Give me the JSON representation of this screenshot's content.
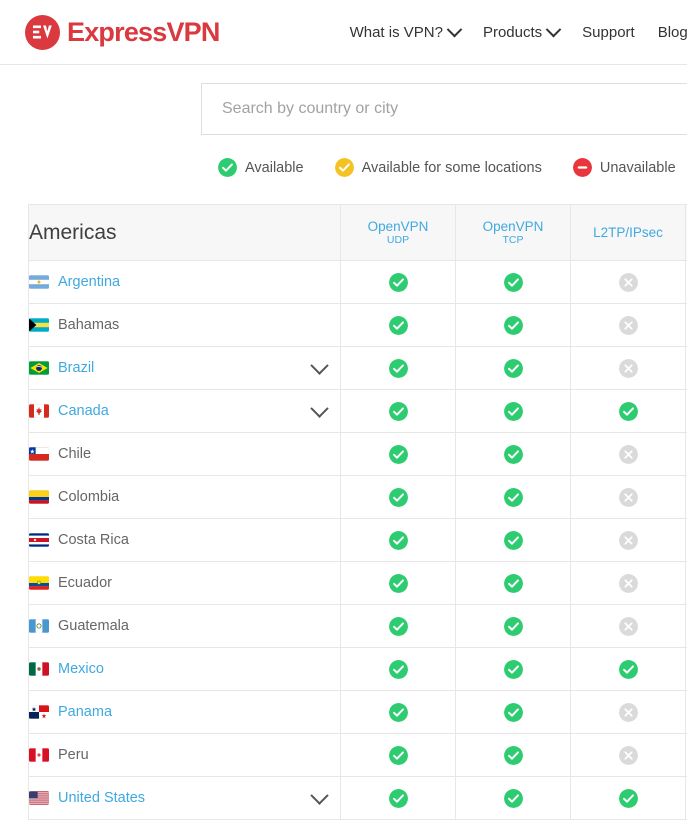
{
  "header": {
    "brand_name": "ExpressVPN",
    "brand_icon": "expressvpn-ev-logo-icon",
    "nav": [
      {
        "label": "What is VPN?",
        "has_dropdown": true
      },
      {
        "label": "Products",
        "has_dropdown": true
      },
      {
        "label": "Support",
        "has_dropdown": false
      },
      {
        "label": "Blog",
        "has_dropdown": false
      }
    ]
  },
  "search": {
    "value": "",
    "placeholder": "Search by country or city",
    "icon": "search-input"
  },
  "legend": [
    {
      "label": "Available",
      "icon": "check-circle-icon",
      "color": "#2ecc71"
    },
    {
      "label": "Available for some locations",
      "icon": "check-circle-icon",
      "color": "#f5c224"
    },
    {
      "label": "Unavailable",
      "icon": "minus-circle-icon",
      "color": "#e8363d"
    }
  ],
  "colors": {
    "brand_red": "#da3940",
    "link_blue": "#3fa9e0",
    "available_green": "#2ecc71",
    "partial_yellow": "#f5c224",
    "unavailable_red": "#e8363d",
    "cell_off_gray": "#dadada",
    "header_bg": "#f7f7f7",
    "border": "#e7e7e7"
  },
  "table": {
    "region_title": "Americas",
    "columns": [
      {
        "main": "OpenVPN",
        "sub": "UDP"
      },
      {
        "main": "OpenVPN",
        "sub": "TCP"
      },
      {
        "main": "L2TP/IPsec",
        "sub": ""
      },
      {
        "main": "",
        "sub": ""
      }
    ],
    "rows": [
      {
        "country": "Argentina",
        "flag": "flag-argentina",
        "is_link": true,
        "expandable": false,
        "status": [
          "available",
          "available",
          "off",
          "off"
        ]
      },
      {
        "country": "Bahamas",
        "flag": "flag-bahamas",
        "is_link": false,
        "expandable": false,
        "status": [
          "available",
          "available",
          "off",
          "off"
        ]
      },
      {
        "country": "Brazil",
        "flag": "flag-brazil",
        "is_link": true,
        "expandable": true,
        "status": [
          "available",
          "available",
          "off",
          "off"
        ]
      },
      {
        "country": "Canada",
        "flag": "flag-canada",
        "is_link": true,
        "expandable": true,
        "status": [
          "available",
          "available",
          "available",
          "off"
        ]
      },
      {
        "country": "Chile",
        "flag": "flag-chile",
        "is_link": false,
        "expandable": false,
        "status": [
          "available",
          "available",
          "off",
          "off"
        ]
      },
      {
        "country": "Colombia",
        "flag": "flag-colombia",
        "is_link": false,
        "expandable": false,
        "status": [
          "available",
          "available",
          "off",
          "off"
        ]
      },
      {
        "country": "Costa Rica",
        "flag": "flag-costa-rica",
        "is_link": false,
        "expandable": false,
        "status": [
          "available",
          "available",
          "off",
          "off"
        ]
      },
      {
        "country": "Ecuador",
        "flag": "flag-ecuador",
        "is_link": false,
        "expandable": false,
        "status": [
          "available",
          "available",
          "off",
          "off"
        ]
      },
      {
        "country": "Guatemala",
        "flag": "flag-guatemala",
        "is_link": false,
        "expandable": false,
        "status": [
          "available",
          "available",
          "off",
          "off"
        ]
      },
      {
        "country": "Mexico",
        "flag": "flag-mexico",
        "is_link": true,
        "expandable": false,
        "status": [
          "available",
          "available",
          "available",
          "off"
        ]
      },
      {
        "country": "Panama",
        "flag": "flag-panama",
        "is_link": true,
        "expandable": false,
        "status": [
          "available",
          "available",
          "off",
          "off"
        ]
      },
      {
        "country": "Peru",
        "flag": "flag-peru",
        "is_link": false,
        "expandable": false,
        "status": [
          "available",
          "available",
          "off",
          "off"
        ]
      },
      {
        "country": "United States",
        "flag": "flag-united-states",
        "is_link": true,
        "expandable": true,
        "status": [
          "available",
          "available",
          "available",
          "off"
        ]
      }
    ]
  }
}
